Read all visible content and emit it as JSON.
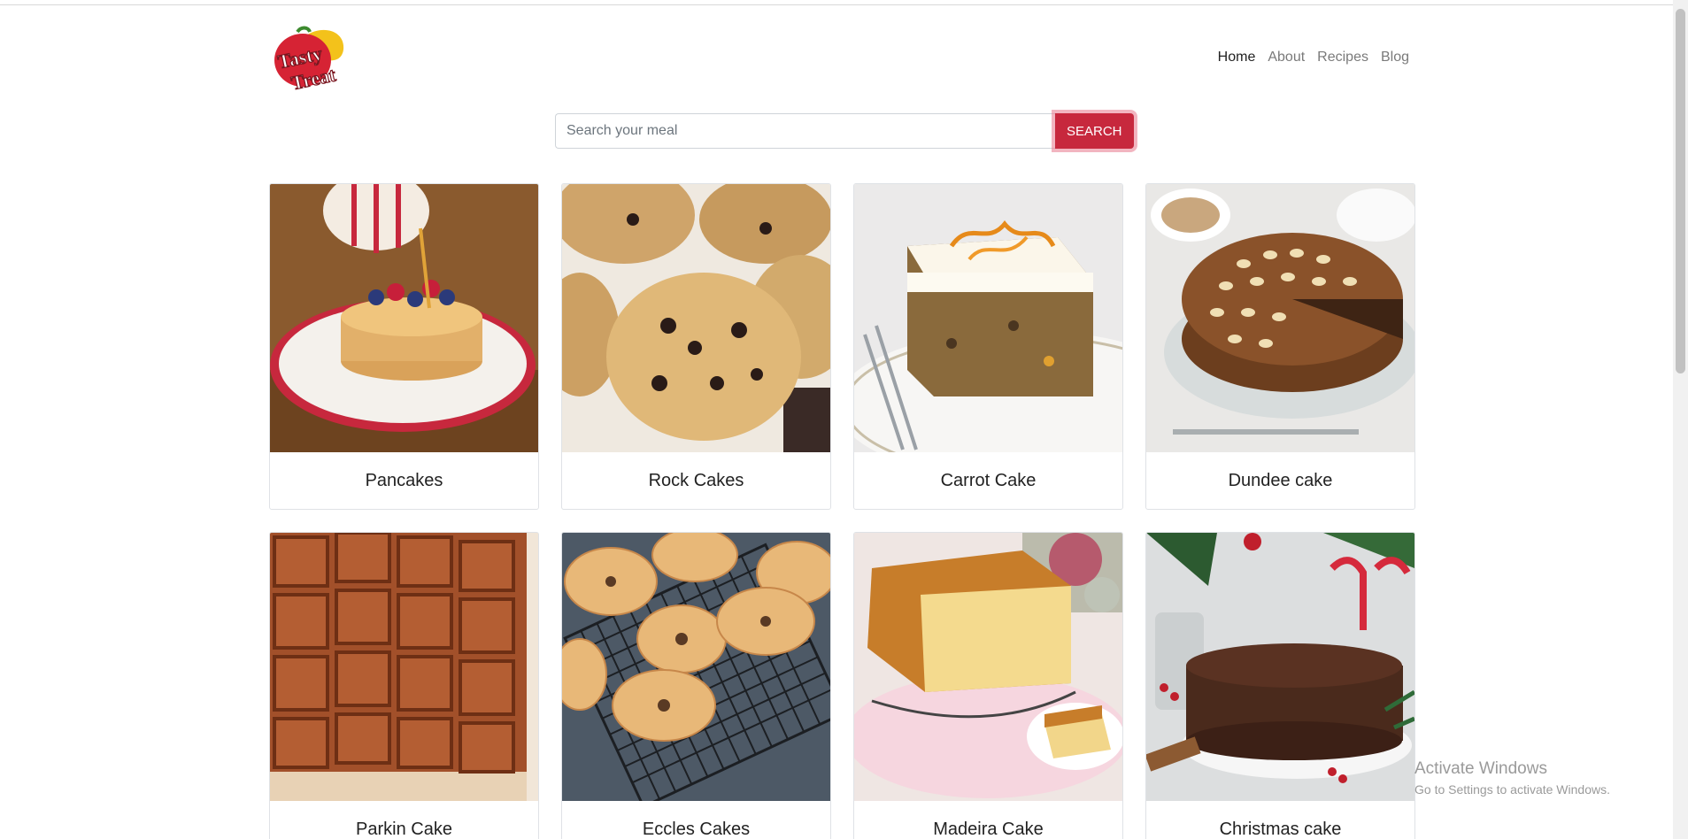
{
  "header": {
    "logo_text_1": "Tasty",
    "logo_text_2": "Treat",
    "nav": [
      {
        "label": "Home",
        "active": true
      },
      {
        "label": "About",
        "active": false
      },
      {
        "label": "Recipes",
        "active": false
      },
      {
        "label": "Blog",
        "active": false
      }
    ]
  },
  "search": {
    "placeholder": "Search your meal",
    "value": "",
    "button_label": "SEARCH"
  },
  "meals": [
    {
      "name": "Pancakes"
    },
    {
      "name": "Rock Cakes"
    },
    {
      "name": "Carrot Cake"
    },
    {
      "name": "Dundee cake"
    },
    {
      "name": "Parkin Cake"
    },
    {
      "name": "Eccles Cakes"
    },
    {
      "name": "Madeira Cake"
    },
    {
      "name": "Christmas cake"
    }
  ],
  "watermark": {
    "title": "Activate Windows",
    "subtitle": "Go to Settings to activate Windows."
  },
  "colors": {
    "accent": "#c7283d",
    "nav_active": "#222222",
    "nav_inactive": "#7a7a7a"
  }
}
